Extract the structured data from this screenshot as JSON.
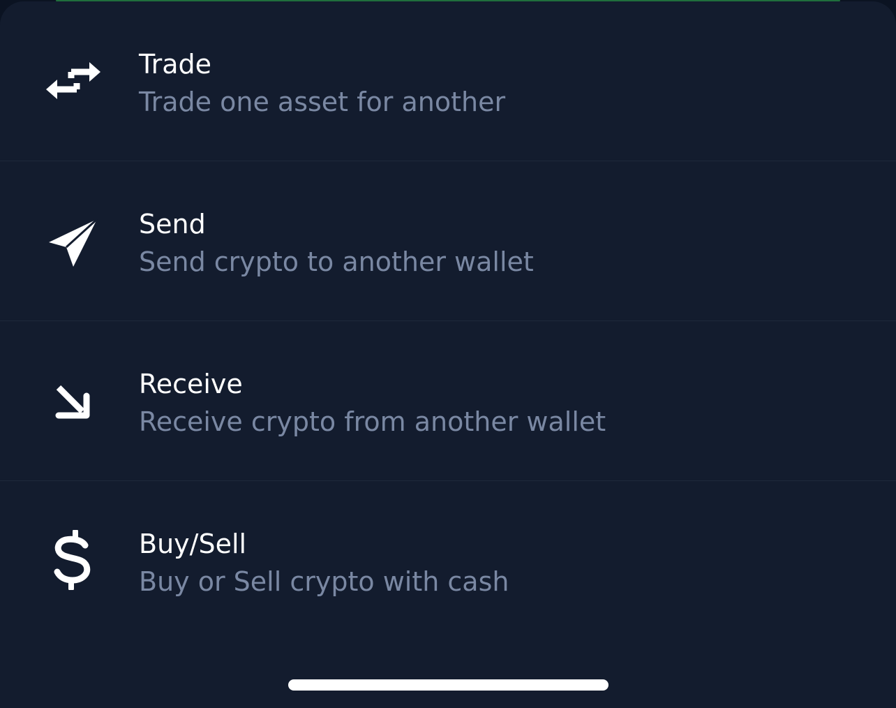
{
  "actions": [
    {
      "icon": "swap-arrows-icon",
      "title": "Trade",
      "subtitle": "Trade one asset for another"
    },
    {
      "icon": "send-paper-plane-icon",
      "title": "Send",
      "subtitle": "Send crypto to another wallet"
    },
    {
      "icon": "receive-arrow-icon",
      "title": "Receive",
      "subtitle": "Receive crypto from another wallet"
    },
    {
      "icon": "dollar-sign-icon",
      "title": "Buy/Sell",
      "subtitle": "Buy or Sell crypto with cash"
    }
  ],
  "colors": {
    "sheet_background": "#131c2e",
    "title": "#ffffff",
    "subtitle": "#7a88a3",
    "divider": "#1e293b",
    "accent": "#1f6f3c"
  }
}
